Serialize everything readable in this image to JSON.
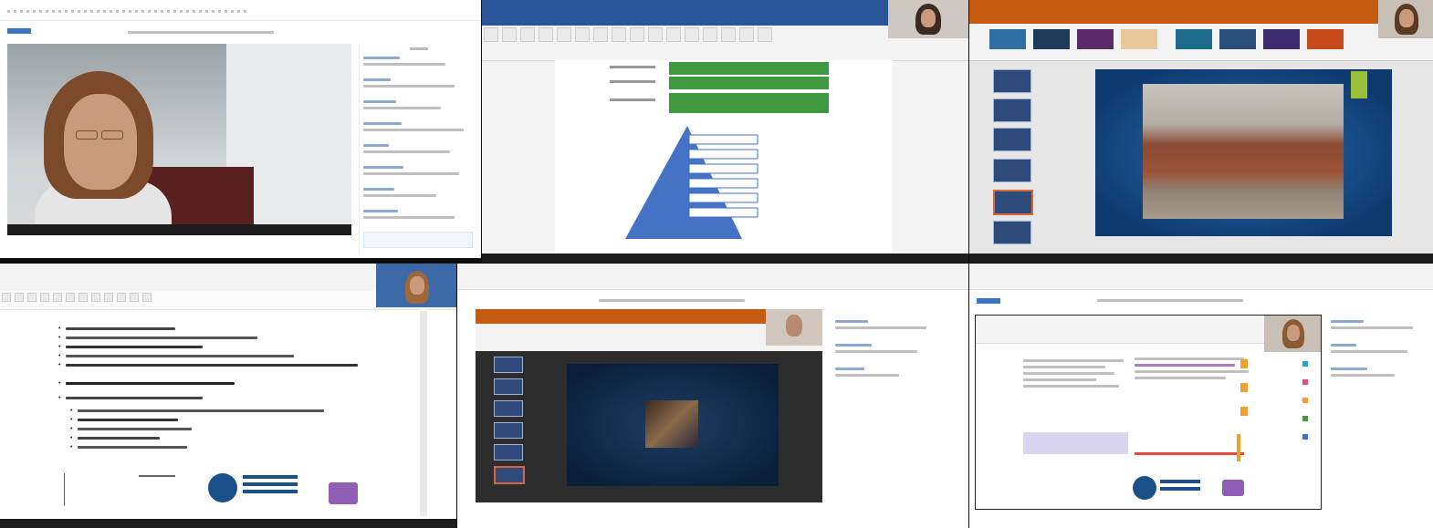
{
  "meta": {
    "accent_blue": "#2b579a",
    "accent_orange": "#c55a11",
    "accent_green": "#3f9a3f",
    "accent_purple": "#8e5fb5"
  },
  "tiles": {
    "t1": {
      "label": "participant-1-zoom"
    },
    "t2": {
      "label": "participant-2-word"
    },
    "t3": {
      "label": "participant-3-powerpoint"
    },
    "t4": {
      "label": "participant-4-document"
    },
    "t5": {
      "label": "participant-5-powerpoint-share"
    },
    "t6": {
      "label": "participant-6-document-share"
    }
  },
  "icons": [
    "chat-icon",
    "video-icon",
    "mic-icon",
    "slide-thumbnail-icon",
    "logo-icon"
  ]
}
